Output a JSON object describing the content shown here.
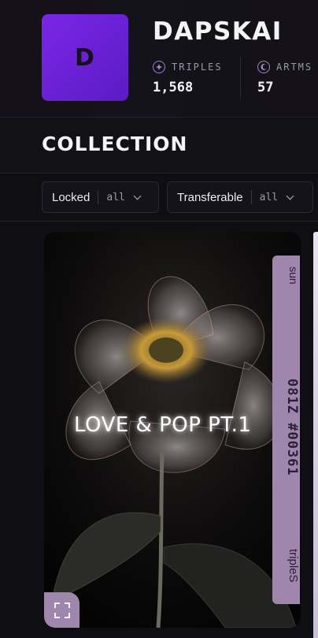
{
  "profile": {
    "avatar_letter": "D",
    "name": "DAPSKAI",
    "stats": {
      "triples": {
        "label": "TRIPLES",
        "value": "1,568",
        "icon": "compass-icon"
      },
      "artms": {
        "label": "ARTMS",
        "value": "57",
        "icon": "moon-icon"
      }
    }
  },
  "collection": {
    "title": "COLLECTION",
    "filters": {
      "locked": {
        "label": "Locked",
        "value": "all"
      },
      "transferable": {
        "label": "Transferable",
        "value": "all"
      }
    }
  },
  "card": {
    "artwork_title": "LOVE & POP PT.1",
    "tab_top": "sun",
    "tab_mid": "081Z #00361",
    "tab_bottom": "tripleS",
    "accent": "#9f86ad",
    "expand_icon": "expand-icon"
  },
  "colors": {
    "avatar": "#7b26e6",
    "background": "#0f0f13"
  }
}
